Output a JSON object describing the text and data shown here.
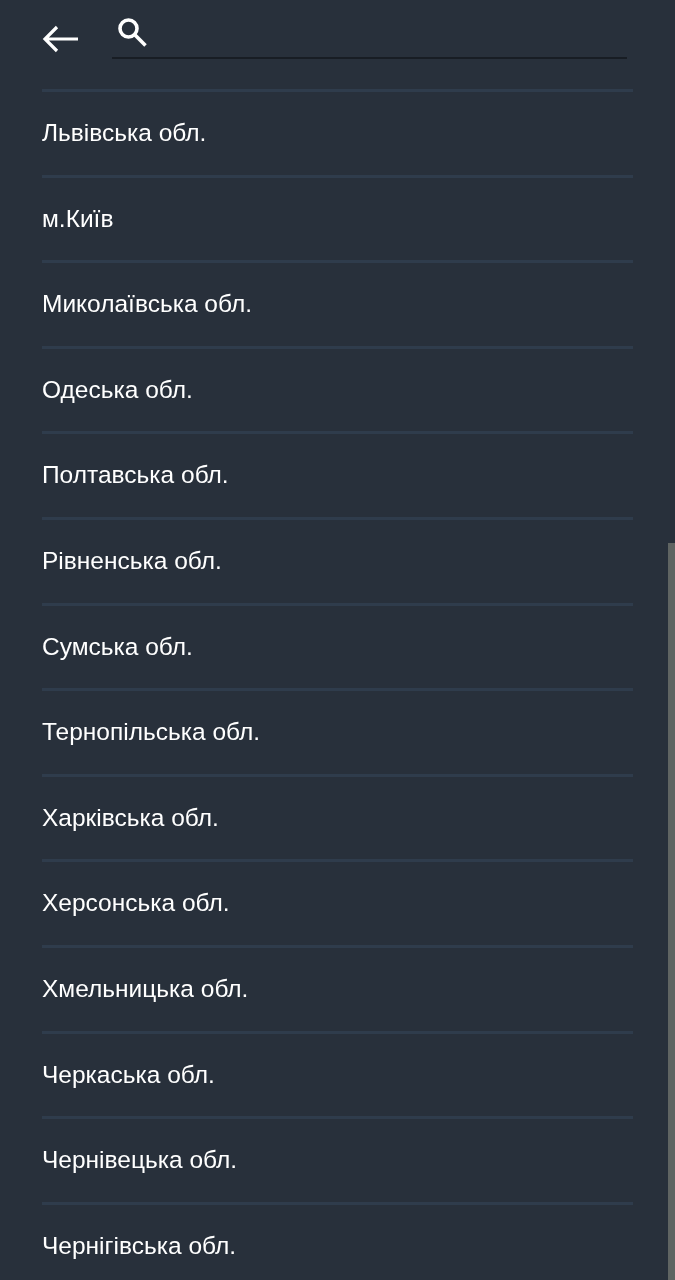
{
  "regions": [
    {
      "label": "Львівська обл."
    },
    {
      "label": "м.Київ"
    },
    {
      "label": "Миколаївська обл."
    },
    {
      "label": "Одеська обл."
    },
    {
      "label": "Полтавська обл."
    },
    {
      "label": "Рівненська обл."
    },
    {
      "label": "Сумська обл."
    },
    {
      "label": "Тернопільська обл."
    },
    {
      "label": "Харківська обл."
    },
    {
      "label": "Херсонська обл."
    },
    {
      "label": "Хмельницька обл."
    },
    {
      "label": "Черкаська обл."
    },
    {
      "label": "Чернівецька обл."
    },
    {
      "label": "Чернігівська обл."
    }
  ]
}
